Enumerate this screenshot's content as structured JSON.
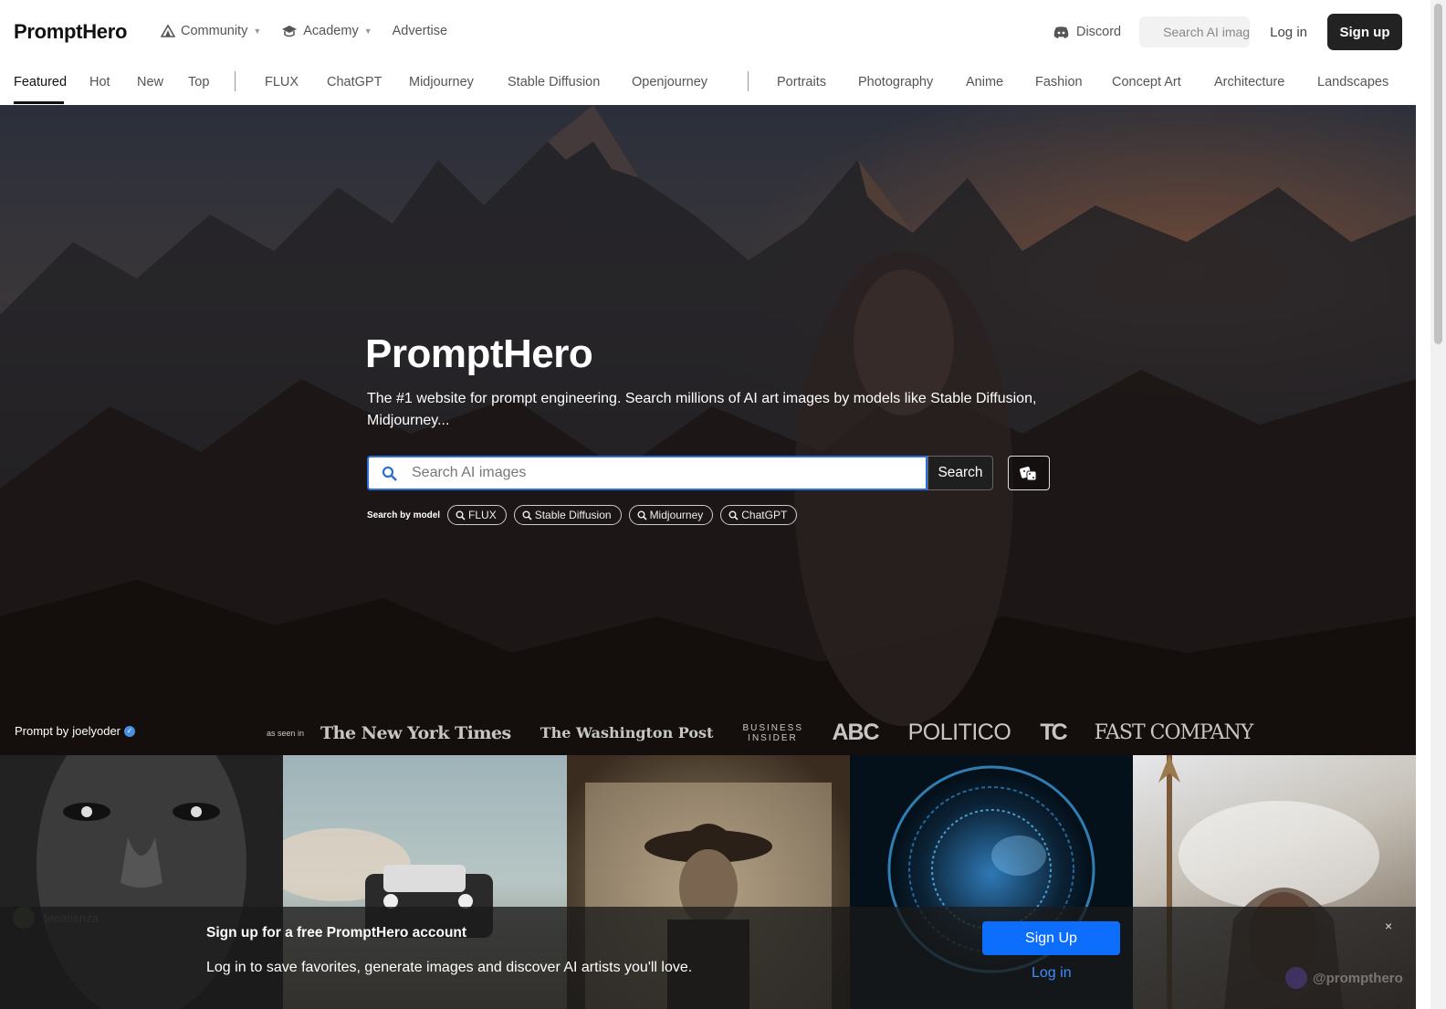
{
  "header": {
    "brand": "PromptHero",
    "topnav": [
      {
        "label": "Community",
        "has_caret": true
      },
      {
        "label": "Academy",
        "has_caret": true
      },
      {
        "label": "Advertise",
        "has_caret": false
      }
    ],
    "discord_label": "Discord",
    "search_placeholder": "Search AI images",
    "login_label": "Log in",
    "signup_label": "Sign up"
  },
  "category_tabs": {
    "active": "Featured",
    "items": [
      "Featured",
      "Hot",
      "New",
      "Top",
      "FLUX",
      "ChatGPT",
      "Midjourney",
      "Stable Diffusion",
      "Openjourney",
      "Portraits",
      "Photography",
      "Anime",
      "Fashion",
      "Concept Art",
      "Architecture",
      "Landscapes"
    ]
  },
  "hero": {
    "title": "PromptHero",
    "subtitle": "The #1 website for prompt engineering. Search millions of AI art images by models like Stable Diffusion, Midjourney...",
    "search_placeholder": "Search AI images",
    "search_button": "Search",
    "model_label": "Search by model",
    "models": [
      "FLUX",
      "Stable Diffusion",
      "Midjourney",
      "ChatGPT"
    ],
    "prompt_by_prefix": "Prompt by",
    "prompt_by_user": "joelyoder",
    "seen_in_label": "as seen in",
    "press_logos": [
      "The New York Times",
      "The Washington Post",
      "BUSINESS INSIDER",
      "ABC",
      "POLITICO",
      "TC",
      "FAST COMPANY"
    ]
  },
  "gallery": {
    "first_tile_user": "teoatienza"
  },
  "signup_banner": {
    "title": "Sign up for a free PromptHero account",
    "text": "Log in to save favorites, generate images and discover AI artists you'll love.",
    "button": "Sign Up",
    "login": "Log in",
    "close": "×",
    "watermark": "@prompthero"
  },
  "colors": {
    "primary_button": "#0d6efd",
    "link": "#3d8bfd",
    "dark_button": "#222222",
    "search_focus_border": "#2b6fd6"
  }
}
